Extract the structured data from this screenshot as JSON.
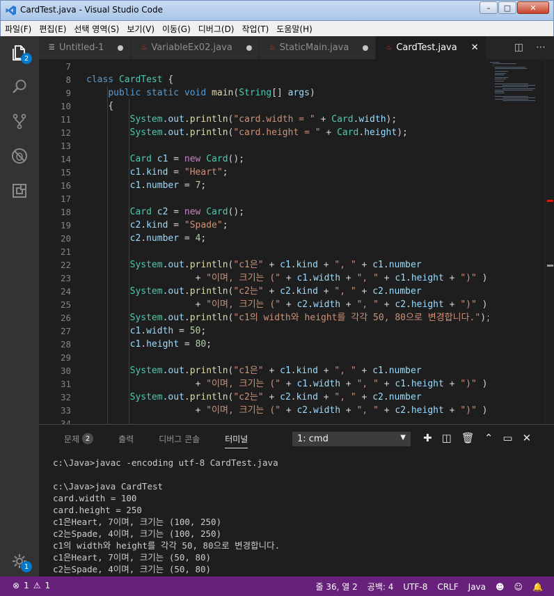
{
  "window": {
    "title": "CardTest.java - Visual Studio Code",
    "minimize": "–",
    "maximize": "□",
    "close": "✕"
  },
  "menu": [
    "파일(F)",
    "편집(E)",
    "선택 영역(S)",
    "보기(V)",
    "이동(G)",
    "디버그(D)",
    "작업(T)",
    "도움말(H)"
  ],
  "activity": {
    "explorer_badge": "2",
    "settings_badge": "1"
  },
  "tabs": [
    {
      "label": "Untitled-1",
      "icon": "file-icon",
      "dirty": true
    },
    {
      "label": "VariableEx02.java",
      "icon": "java-icon",
      "dirty": true
    },
    {
      "label": "StaticMain.java",
      "icon": "java-icon",
      "dirty": true
    },
    {
      "label": "CardTest.java",
      "icon": "java-icon",
      "active": true
    }
  ],
  "tab_close": "✕",
  "editor": {
    "line_numbers": [
      "7",
      "8",
      "9",
      "10",
      "11",
      "12",
      "13",
      "14",
      "15",
      "16",
      "17",
      "18",
      "19",
      "20",
      "21",
      "22",
      "23",
      "24",
      "25",
      "26",
      "27",
      "28",
      "29",
      "30",
      "31",
      "32",
      "33",
      "34"
    ],
    "lines": [
      "",
      "class CardTest {",
      "    public static void main(String[] args)",
      "    {",
      "        System.out.println(\"card.width = \" + Card.width);",
      "        System.out.println(\"card.height = \" + Card.height);",
      "",
      "        Card c1 = new Card();",
      "        c1.kind = \"Heart\";",
      "        c1.number = 7;",
      "",
      "        Card c2 = new Card();",
      "        c2.kind = \"Spade\";",
      "        c2.number = 4;",
      "",
      "        System.out.println(\"c1은\" + c1.kind + \", \" + c1.number",
      "                    + \"이며, 크기는 (\" + c1.width + \", \" + c1.height + \")\" );",
      "        System.out.println(\"c2는\" + c2.kind + \", \" + c2.number",
      "                    + \"이며, 크기는 (\" + c2.width + \", \" + c2.height + \")\" );",
      "        System.out.println(\"c1의 width와 height를 각각 50, 80으로 변경합니다.\");",
      "        c1.width = 50;",
      "        c1.height = 80;",
      "",
      "        System.out.println(\"c1은\" + c1.kind + \", \" + c1.number",
      "                    + \"이며, 크기는 (\" + c1.width + \", \" + c1.height + \")\" );",
      "        System.out.println(\"c2는\" + c2.kind + \", \" + c2.number",
      "                    + \"이며, 크기는 (\" + c2.width + \", \" + c2.height + \")\" );",
      ""
    ]
  },
  "panel": {
    "tabs": [
      {
        "label": "문제",
        "badge": "2"
      },
      {
        "label": "출력"
      },
      {
        "label": "디버그 콘솔"
      },
      {
        "label": "터미널",
        "active": true
      }
    ],
    "terminal_select": "1: cmd",
    "terminal_lines": [
      "c:\\Java>javac -encoding utf-8 CardTest.java",
      "",
      "c:\\Java>java CardTest",
      "card.width = 100",
      "card.height = 250",
      "c1은Heart, 7이며, 크기는 (100, 250)",
      "c2는Spade, 4이며, 크기는 (100, 250)",
      "c1의 width와 height를 각각 50, 80으로 변경합니다.",
      "c1은Heart, 7이며, 크기는 (50, 80)",
      "c2는Spade, 4이며, 크기는 (50, 80)"
    ]
  },
  "status": {
    "errors": "1",
    "warnings": "1",
    "position": "줄 36, 열 2",
    "spaces": "공백: 4",
    "encoding": "UTF-8",
    "eol": "CRLF",
    "language": "Java"
  },
  "colors": {
    "statusbar": "#68217a",
    "activity": "#333333",
    "editor_bg": "#1e1e1e",
    "accent": "#007acc"
  }
}
